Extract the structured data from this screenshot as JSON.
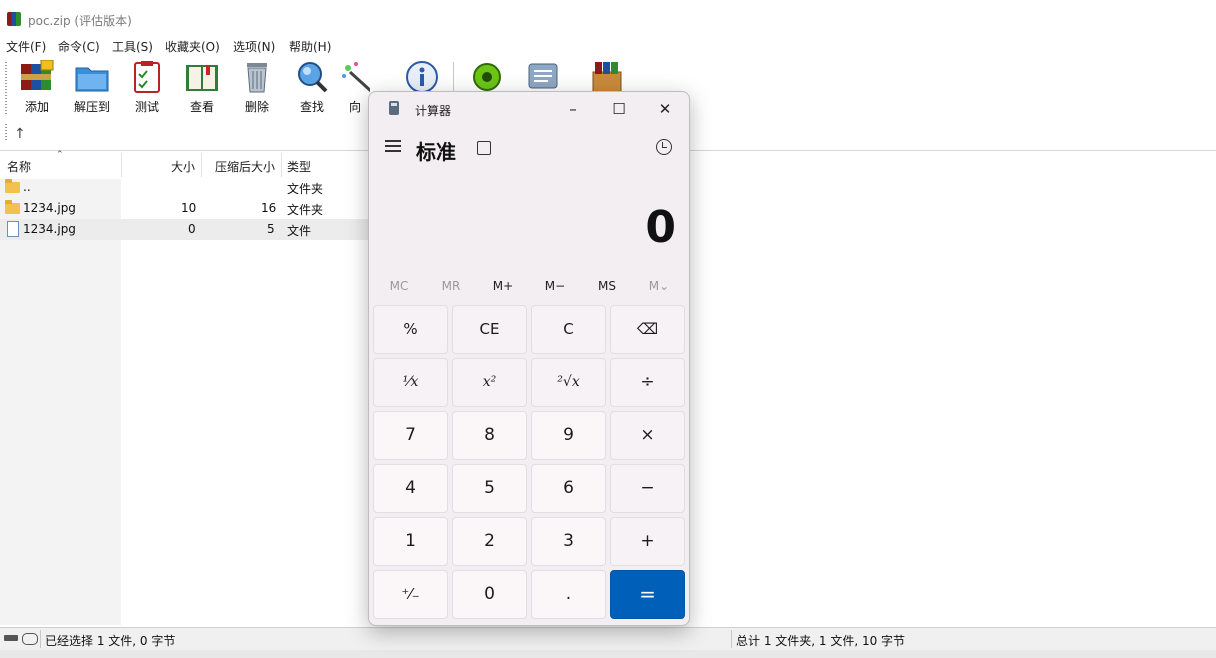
{
  "window": {
    "title": "poc.zip (评估版本)"
  },
  "menu": [
    "文件(F)",
    "命令(C)",
    "工具(S)",
    "收藏夹(O)",
    "选项(N)",
    "帮助(H)"
  ],
  "toolbar": {
    "add": "添加",
    "extract": "解压到",
    "test": "测试",
    "view": "查看",
    "delete": "删除",
    "find": "查找",
    "wizard": "向"
  },
  "columns": {
    "name": "名称",
    "size": "大小",
    "packed": "压缩后大小",
    "type": "类型"
  },
  "files": [
    {
      "name": "..",
      "size": "",
      "packed": "",
      "type": "文件夹",
      "icon": "folder-icon"
    },
    {
      "name": "1234.jpg",
      "size": "10",
      "packed": "16",
      "type": "文件夹",
      "icon": "folder-icon"
    },
    {
      "name": "1234.jpg",
      "size": "0",
      "packed": "5",
      "type": "文件",
      "icon": "file-icon"
    }
  ],
  "status": {
    "left": "已经选择 1 文件, 0 字节",
    "right": "总计 1 文件夹, 1 文件, 10 字节"
  },
  "calculator": {
    "title": "计算器",
    "mode": "标准",
    "display": "0",
    "memory": [
      "MC",
      "MR",
      "M+",
      "M−",
      "MS",
      "M⌄"
    ],
    "keys": {
      "percent": "%",
      "ce": "CE",
      "c": "C",
      "backspace": "⌫",
      "reciprocal": "¹⁄x",
      "square": "x²",
      "sqrt": "²√x",
      "divide": "÷",
      "seven": "7",
      "eight": "8",
      "nine": "9",
      "multiply": "×",
      "four": "4",
      "five": "5",
      "six": "6",
      "minus": "−",
      "one": "1",
      "two": "2",
      "three": "3",
      "plus": "+",
      "negate": "⁺⁄₋",
      "zero": "0",
      "decimal": ".",
      "equals": "="
    },
    "accent": "#005fb8"
  }
}
